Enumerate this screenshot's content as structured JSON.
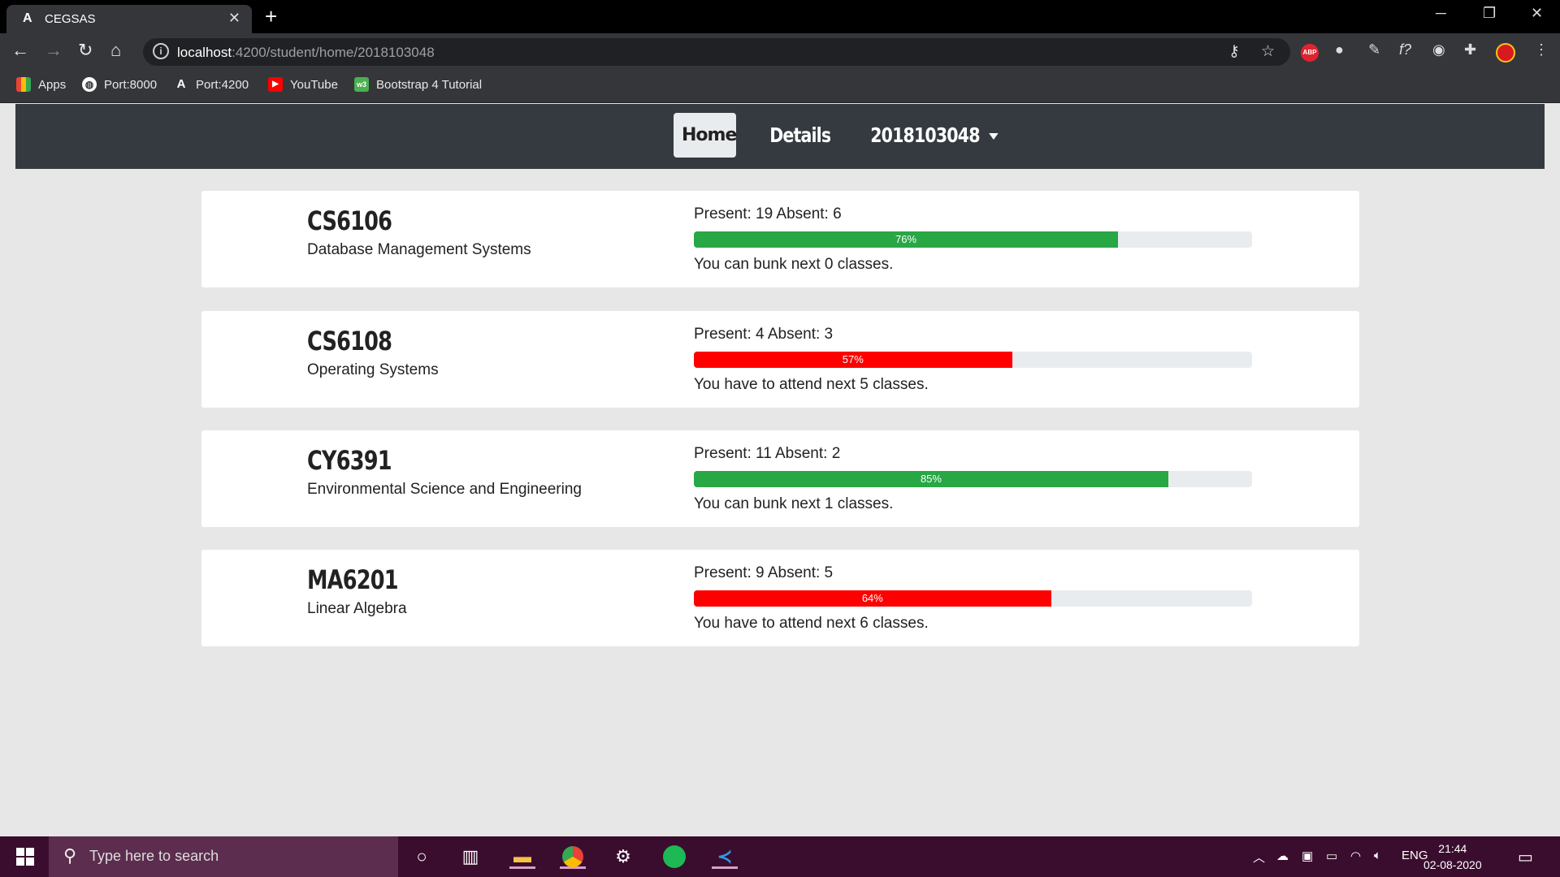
{
  "browser": {
    "tab_title": "CEGSAS",
    "tab_favicon": "A",
    "url_host": "localhost",
    "url_path": ":4200/student/home/2018103048",
    "bookmarks": [
      {
        "label": "Apps",
        "icon": "apps-grid-icon"
      },
      {
        "label": "Port:8000",
        "icon": "globe-icon"
      },
      {
        "label": "Port:4200",
        "icon": "angular-icon"
      },
      {
        "label": "YouTube",
        "icon": "youtube-icon"
      },
      {
        "label": "Bootstrap 4 Tutorial",
        "icon": "w3schools-icon"
      }
    ],
    "abp_label": "ABP"
  },
  "nav": {
    "home": "Home",
    "details": "Details",
    "user": "2018103048"
  },
  "courses": [
    {
      "code": "CS6106",
      "name": "Database Management Systems",
      "stats": "Present: 19 Absent: 6",
      "percent": 76,
      "percent_label": "76%",
      "status": "good",
      "message": "You can bunk next 0 classes."
    },
    {
      "code": "CS6108",
      "name": "Operating Systems",
      "stats": "Present: 4 Absent: 3",
      "percent": 57,
      "percent_label": "57%",
      "status": "bad",
      "message": "You have to attend next 5 classes."
    },
    {
      "code": "CY6391",
      "name": "Environmental Science and Engineering",
      "stats": "Present: 11 Absent: 2",
      "percent": 85,
      "percent_label": "85%",
      "status": "good",
      "message": "You can bunk next 1 classes."
    },
    {
      "code": "MA6201",
      "name": "Linear Algebra",
      "stats": "Present: 9 Absent: 5",
      "percent": 64,
      "percent_label": "64%",
      "status": "bad",
      "message": "You have to attend next 6 classes."
    }
  ],
  "colors": {
    "good": "#28a745",
    "bad": "#ff0000",
    "navbar": "#343a40",
    "taskbar": "#3a0d2e"
  },
  "taskbar": {
    "search_placeholder": "Type here to search",
    "language": "ENG",
    "time": "21:44",
    "date": "02-08-2020"
  }
}
